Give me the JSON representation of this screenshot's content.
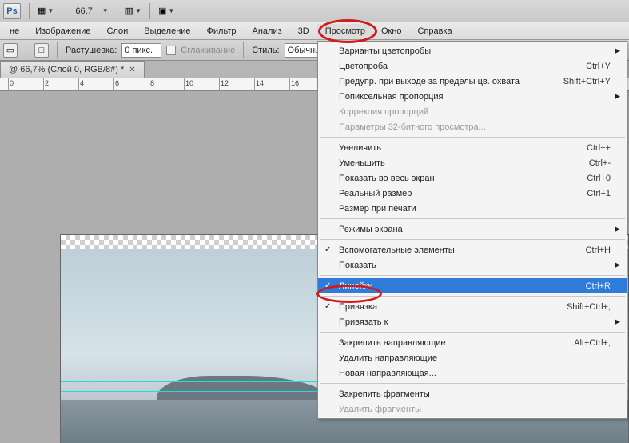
{
  "topbar": {
    "zoom": "66,7"
  },
  "menubar": {
    "items": [
      "не",
      "Изображение",
      "Слои",
      "Выделение",
      "Фильтр",
      "Анализ",
      "3D",
      "Просмотр",
      "Окно",
      "Справка"
    ]
  },
  "optbar": {
    "feather_label": "Растушевка:",
    "feather_value": "0 пикс.",
    "antialias": "Сглаживание",
    "style_label": "Стиль:",
    "style_value": "Обычный"
  },
  "doctab": {
    "title": "@ 66,7% (Слой 0, RGB/8#) *"
  },
  "ruler": {
    "ticks": [
      "0",
      "2",
      "4",
      "6",
      "8",
      "10",
      "12",
      "14",
      "16"
    ]
  },
  "menu": {
    "items": [
      {
        "label": "Варианты цветопробы",
        "submenu": true
      },
      {
        "label": "Цветопроба",
        "shortcut": "Ctrl+Y"
      },
      {
        "label": "Предупр. при выходе за пределы цв. охвата",
        "shortcut": "Shift+Ctrl+Y"
      },
      {
        "label": "Попиксельная пропорция",
        "submenu": true
      },
      {
        "label": "Коррекция пропорций",
        "disabled": true
      },
      {
        "label": "Параметры 32-битного просмотра...",
        "disabled": true
      },
      {
        "sep": true
      },
      {
        "label": "Увеличить",
        "shortcut": "Ctrl++"
      },
      {
        "label": "Уменьшить",
        "shortcut": "Ctrl+-"
      },
      {
        "label": "Показать во весь экран",
        "shortcut": "Ctrl+0"
      },
      {
        "label": "Реальный размер",
        "shortcut": "Ctrl+1"
      },
      {
        "label": "Размер при печати"
      },
      {
        "sep": true
      },
      {
        "label": "Режимы экрана",
        "submenu": true
      },
      {
        "sep": true
      },
      {
        "label": "Вспомогательные элементы",
        "check": true,
        "shortcut": "Ctrl+H"
      },
      {
        "label": "Показать",
        "submenu": true
      },
      {
        "sep": true
      },
      {
        "label": "Линейки",
        "check": true,
        "shortcut": "Ctrl+R",
        "highlight": true
      },
      {
        "sep": true
      },
      {
        "label": "Привязка",
        "check": true,
        "shortcut": "Shift+Ctrl+;"
      },
      {
        "label": "Привязать к",
        "submenu": true
      },
      {
        "sep": true
      },
      {
        "label": "Закрепить направляющие",
        "shortcut": "Alt+Ctrl+;"
      },
      {
        "label": "Удалить направляющие"
      },
      {
        "label": "Новая направляющая..."
      },
      {
        "sep": true
      },
      {
        "label": "Закрепить фрагменты"
      },
      {
        "label": "Удалить фрагменты",
        "disabled": true
      }
    ]
  }
}
